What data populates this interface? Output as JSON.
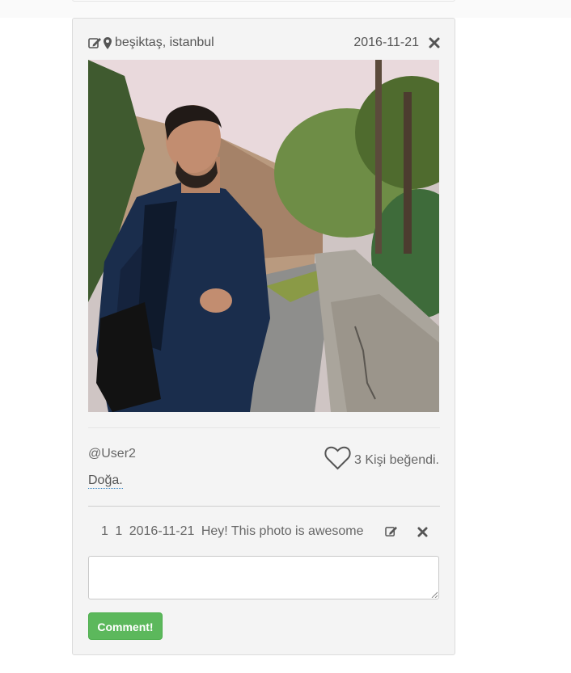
{
  "post": {
    "location": "beşiktaş, istanbul",
    "date": "2016-11-21",
    "username": "@User2",
    "tag": "Doğa.",
    "like_count_text": "3 Kişi beğendi."
  },
  "comments": [
    {
      "id": "1",
      "user_id": "1",
      "date": "2016-11-21",
      "text": "Hey! This photo is awesome"
    }
  ],
  "comment_form": {
    "placeholder": "",
    "submit_label": "Comment!"
  },
  "icons": {
    "edit": "edit-icon",
    "location": "map-marker-icon",
    "close": "close-icon",
    "like": "heart-icon"
  },
  "colors": {
    "card_background": "#f4f4f4",
    "submit_button": "#5cb85c",
    "tag_underline": "#2a7fc1"
  }
}
